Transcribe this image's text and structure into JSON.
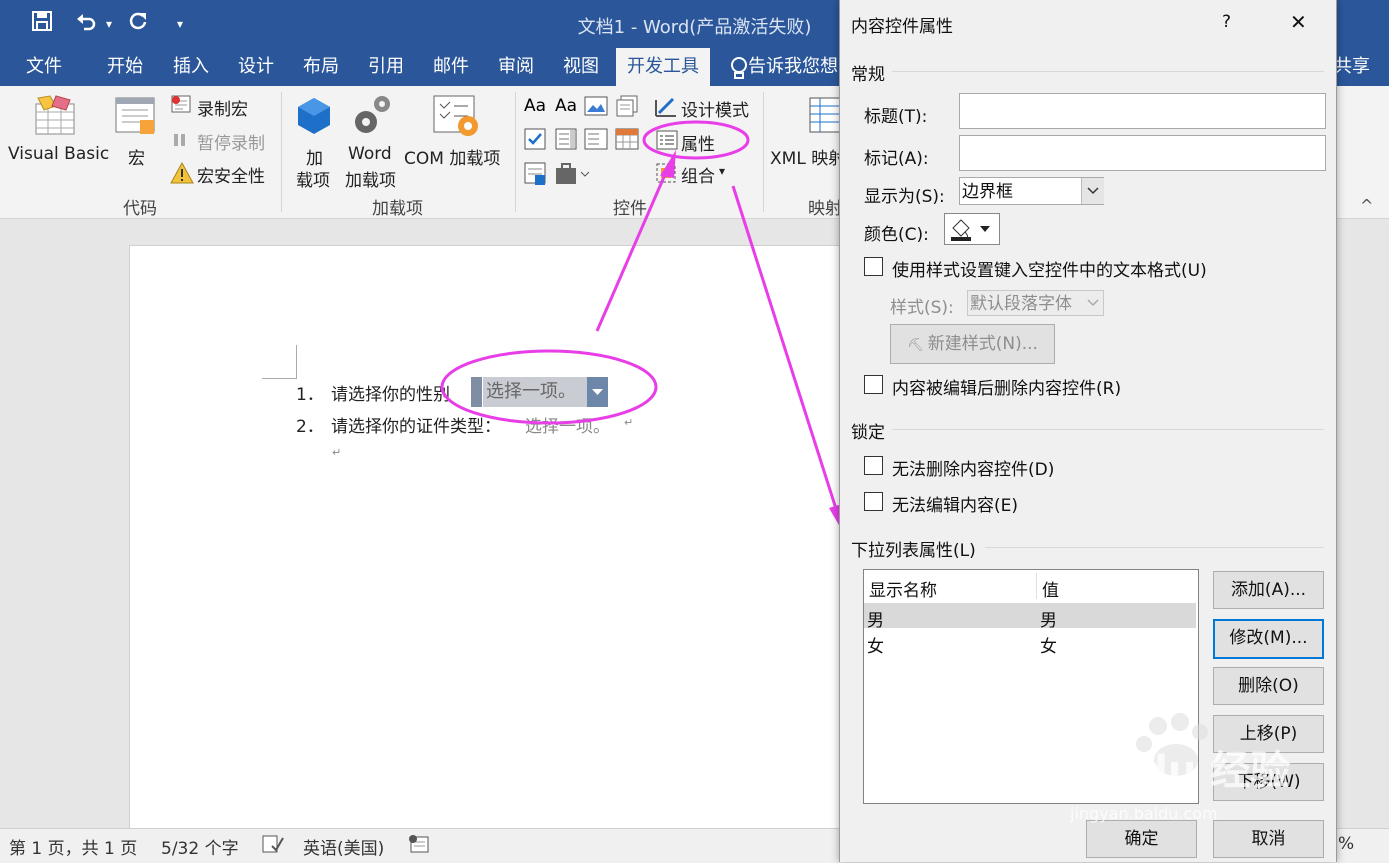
{
  "titlebar": {
    "title": "文档1 - Word(产品激活失败)",
    "qat": {
      "save_icon": "save-icon",
      "undo_icon": "undo-icon",
      "undo_dropdown": "▾",
      "redo_icon": "redo-icon",
      "customize": "▾"
    }
  },
  "tabs": [
    "文件",
    "开始",
    "插入",
    "设计",
    "布局",
    "引用",
    "邮件",
    "审阅",
    "视图",
    "开发工具"
  ],
  "active_tab": "开发工具",
  "tell_me": "告诉我您想",
  "share": "共享",
  "ribbon": {
    "code": {
      "visual_basic": "Visual Basic",
      "macro": "宏",
      "record_macro": "录制宏",
      "pause_recording": "暂停录制",
      "macro_security": "宏安全性",
      "group": "代码"
    },
    "addins": {
      "addins_line1": "加",
      "addins_line2": "载项",
      "word_addins_line1": "Word",
      "word_addins_line2": "加载项",
      "com_addins": "COM 加载项",
      "group": "加载项"
    },
    "controls": {
      "design_mode": "设计模式",
      "properties": "属性",
      "group_btn": "组合",
      "group_btn_caret": "▾",
      "group": "控件"
    },
    "mapping": {
      "xml_mapping": "XML 映射",
      "group": "映射"
    },
    "collapse": "^"
  },
  "document": {
    "line1_num": "1．",
    "line1_text": "请选择你的性别",
    "dropdown_value": "选择一项。",
    "line2_num": "2．",
    "line2_text": "请选择你的证件类型：",
    "line2_placeholder": "选择一项。",
    "para_mark": "↵"
  },
  "status": {
    "page": "第 1 页，共 1 页",
    "words": "5/32 个字",
    "language": "英语(美国)",
    "zoom": "%"
  },
  "dialog": {
    "title": "内容控件属性",
    "help": "?",
    "close": "✕",
    "general": "常规",
    "title_label": "标题(T):",
    "title_value": "",
    "tag_label": "标记(A):",
    "tag_value": "",
    "show_as_label": "显示为(S):",
    "show_as_value": "边界框",
    "color_label": "颜色(C):",
    "use_style_label": "使用样式设置键入空控件中的文本格式(U)",
    "style_label": "样式(S):",
    "style_value": "默认段落字体",
    "new_style": "新建样式(N)...",
    "remove_when_edited": "内容被编辑后删除内容控件(R)",
    "locking": "锁定",
    "cannot_delete": "无法删除内容控件(D)",
    "cannot_edit": "无法编辑内容(E)",
    "dropdown_props": "下拉列表属性(L)",
    "col_display": "显示名称",
    "col_value": "值",
    "rows": [
      {
        "name": "男",
        "value": "男"
      },
      {
        "name": "女",
        "value": "女"
      }
    ],
    "add": "添加(A)...",
    "modify": "修改(M)...",
    "remove": "删除(O)",
    "move_up": "上移(P)",
    "move_down": "下移(W)",
    "ok": "确定",
    "cancel": "取消"
  },
  "watermark": {
    "brand": "Baidu 经验",
    "url": "jingyan.baidu.com"
  },
  "colors": {
    "word_blue": "#2b579a",
    "annotation_magenta": "#e83ee8",
    "focus_blue": "#0078d7"
  }
}
